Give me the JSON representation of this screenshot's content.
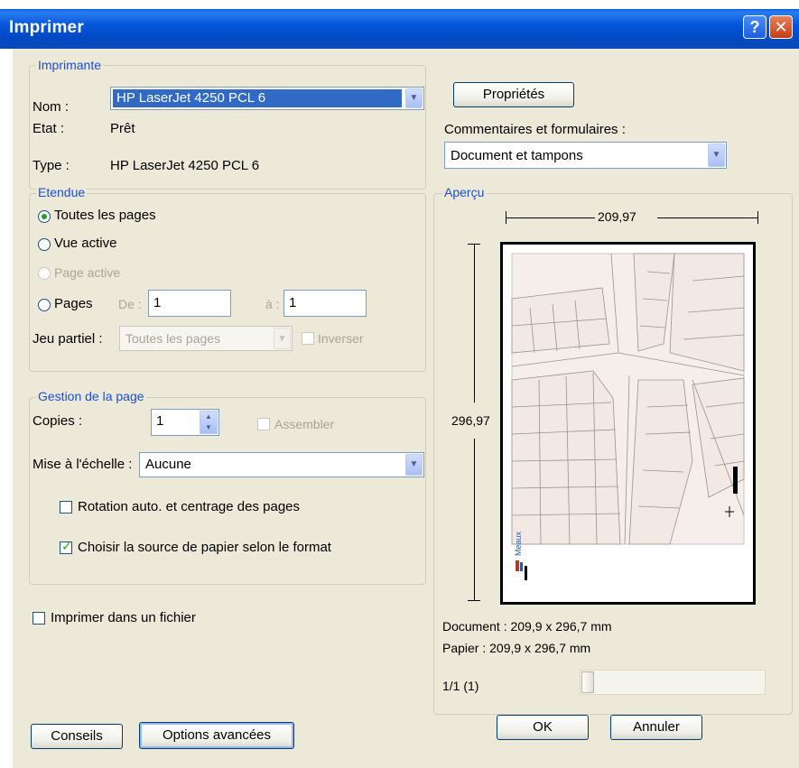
{
  "window": {
    "title": "Imprimer",
    "help_glyph": "?",
    "close_glyph": "✕"
  },
  "printer": {
    "legend": "Imprimante",
    "name_label": "Nom :",
    "name_value": "HP LaserJet 4250 PCL 6",
    "state_label": "Etat :",
    "state_value": "Prêt",
    "type_label": "Type :",
    "type_value": "HP LaserJet 4250 PCL 6",
    "properties_button": "Propriétés",
    "comments_label": "Commentaires et formulaires :",
    "comments_value": "Document et tampons"
  },
  "range": {
    "legend": "Etendue",
    "all_pages": "Toutes les pages",
    "active_view": "Vue active",
    "active_page": "Page active",
    "pages": "Pages",
    "from_label": "De :",
    "from_value": "1",
    "to_label": "à :",
    "to_value": "1",
    "subset_label": "Jeu partiel :",
    "subset_value": "Toutes les pages",
    "reverse_label": "Inverser"
  },
  "page_handling": {
    "legend": "Gestion de la page",
    "copies_label": "Copies :",
    "copies_value": "1",
    "collate_label": "Assembler",
    "scaling_label": "Mise à l'échelle :",
    "scaling_value": "Aucune",
    "auto_rotate_label": "Rotation auto. et centrage des pages",
    "auto_rotate_checked": false,
    "paper_source_label": "Choisir la source de papier selon le format",
    "paper_source_checked": true
  },
  "print_to_file": {
    "label": "Imprimer dans un fichier",
    "checked": false
  },
  "preview": {
    "legend": "Aperçu",
    "width_value": "209,97",
    "height_value": "296,97",
    "map_stamp": "Meaux",
    "document_size": "Document : 209,9 x 296,7 mm",
    "paper_size": "Papier : 209,9 x 296,7 mm",
    "page_indicator": "1/1 (1)"
  },
  "buttons": {
    "tips": "Conseils",
    "advanced": "Options avancées",
    "ok": "OK",
    "cancel": "Annuler"
  },
  "colors": {
    "title_bar": "#0555d9",
    "dialog_bg": "#ece9d8",
    "selection": "#316ac5",
    "legend_text": "#1c4fd6"
  }
}
